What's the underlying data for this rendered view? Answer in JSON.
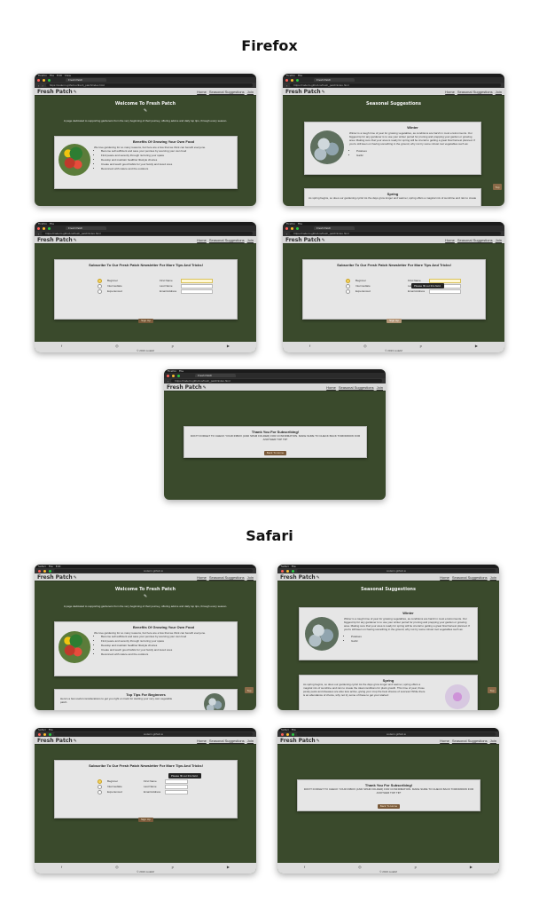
{
  "sections": {
    "firefox": "Firefox",
    "safari": "Safari"
  },
  "browser": {
    "firefox_menu": [
      "Firefox",
      "File",
      "Edit",
      "View",
      "History",
      "Bookmarks",
      "Tools",
      "Window",
      "Help"
    ],
    "safari_menu": [
      "Safari",
      "File",
      "Edit",
      "View",
      "History",
      "Bookmarks",
      "Window",
      "Help"
    ],
    "tab_title": "Fresh Patch",
    "url": "https://coderm.github.io/fresh_patch/index.html",
    "url_safari": "coderm.github.io"
  },
  "site": {
    "logo": "Fresh Patch",
    "nav": [
      "Home",
      "Seasonal Suggestions",
      "Join"
    ]
  },
  "home": {
    "title": "Welcome To Fresh Patch",
    "intro": "A page dedicated to supporting gardeners from the very beginning of their journey, offering advice and daily top tips, through every season.",
    "benefits_title": "Benefits Of Growing Your Own Food",
    "benefits_intro": "We love gardening for so many reasons, but here are a few that we think can benefit everyone.",
    "benefits": [
      "Become self-sufficient and save your pennies by sourcing your own food",
      "Find peace and serenity through nurturing your space",
      "Develop and maintain healthier lifestyle choices",
      "Create and teach good habits for your family and loved ones",
      "Reconnect with nature and the outdoors"
    ],
    "tips_title": "Top Tips For Beginners",
    "tips_intro": "Here's a few useful considerations to get you right on track for starting your very own vegetable patch."
  },
  "seasonal": {
    "title": "Seasonal Suggestions",
    "winter_title": "Winter",
    "winter_text": "Winter is a tough time of year for growing vegetables, as conditions are harsh in most environments. Our biggest tip for any gardener is to use your winter period for pruning and prepping your garden or growing area. Making sure that your area is ready for spring will be crucial to getting a great final harvest planned. If you're still keen on having something in the ground, why not try some robust root vegetables such as:",
    "winter_items": [
      "Potatoes",
      "Garlic"
    ],
    "spring_title": "Spring",
    "spring_text": "As spring begins, so does our gardening cycle! As the days grow longer and warmer, spring offers a magical mix of sunshine and rain to create the ideal conditions for plant growth. This time of year, those pesky pests and diseases are also less active, giving your crop the best chance of success! While there is an abundance of choice, why not try some of these to get your started:"
  },
  "join": {
    "title": "Subscribe To Our Fresh Patch Newsletter For More Tips And Tricks!",
    "levels": [
      "Beginner",
      "Intermediate",
      "Experienced"
    ],
    "fields": [
      "First Name",
      "Last Name",
      "Email Address"
    ],
    "submit": "Sign Up",
    "tooltip": "Please fill out this field."
  },
  "thanks": {
    "title": "Thank You For Subscribing!",
    "text": "DON'T FORGET TO CHECK YOUR INBOX (AND SPAM FOLDER) FOR CONFIRMATION. MAKE SURE TO CHECK BACK TOMORROW FOR ANOTHER TOP TIP!",
    "button": "Back To Home"
  },
  "footer": {
    "icons": [
      "facebook-icon",
      "instagram-icon",
      "pinterest-icon",
      "youtube-icon"
    ],
    "copy": "© 2023 codeM"
  },
  "top_button": "Top",
  "colors": {
    "page_green": "#3a4a2c",
    "card": "#e6e6e6",
    "button_brown": "#7a5a3a",
    "radio_selected": "#f4d35e"
  }
}
